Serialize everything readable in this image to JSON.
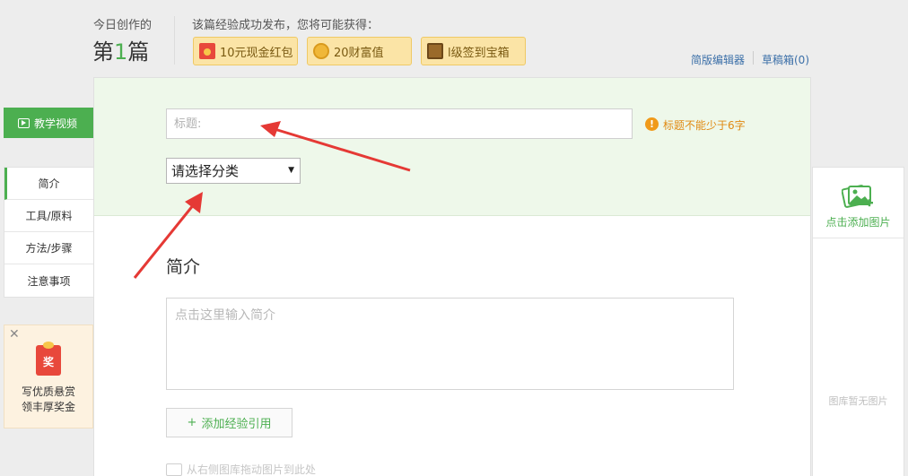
{
  "header": {
    "today_label": "今日创作的",
    "count_prefix": "第",
    "count_value": "1",
    "count_suffix": "篇",
    "reward_title": "该篇经验成功发布，您将可能获得：",
    "rewards": [
      {
        "label": "10元现金红包",
        "icon": "red-envelope-icon"
      },
      {
        "label": "20财富值",
        "icon": "coin-icon"
      },
      {
        "label": "l级签到宝箱",
        "icon": "treasure-chest-icon"
      }
    ],
    "link_simple_editor": "简版编辑器",
    "link_drafts": "草稿箱(0)"
  },
  "left_nav": {
    "video_button": "教学视频",
    "items": [
      {
        "label": "简介",
        "active": true
      },
      {
        "label": "工具/原料",
        "active": false
      },
      {
        "label": "方法/步骤",
        "active": false
      },
      {
        "label": "注意事项",
        "active": false
      }
    ]
  },
  "promo": {
    "badge": "奖",
    "line1": "写优质悬赏",
    "line2": "领丰厚奖金"
  },
  "editor": {
    "title_placeholder": "标题:",
    "title_warning": "标题不能少于6字",
    "category_value": "请选择分类",
    "intro_heading": "简介",
    "intro_placeholder": "点击这里输入简介",
    "add_reference": "添加经验引用",
    "drag_hint": "从右侧图库拖动图片到此处"
  },
  "image_panel": {
    "add_label": "点击添加图片",
    "empty_text": "图库暂无图片"
  },
  "colors": {
    "brand_green": "#4caf50",
    "warning_orange": "#f09a1a",
    "arrow_red": "#e53935"
  }
}
